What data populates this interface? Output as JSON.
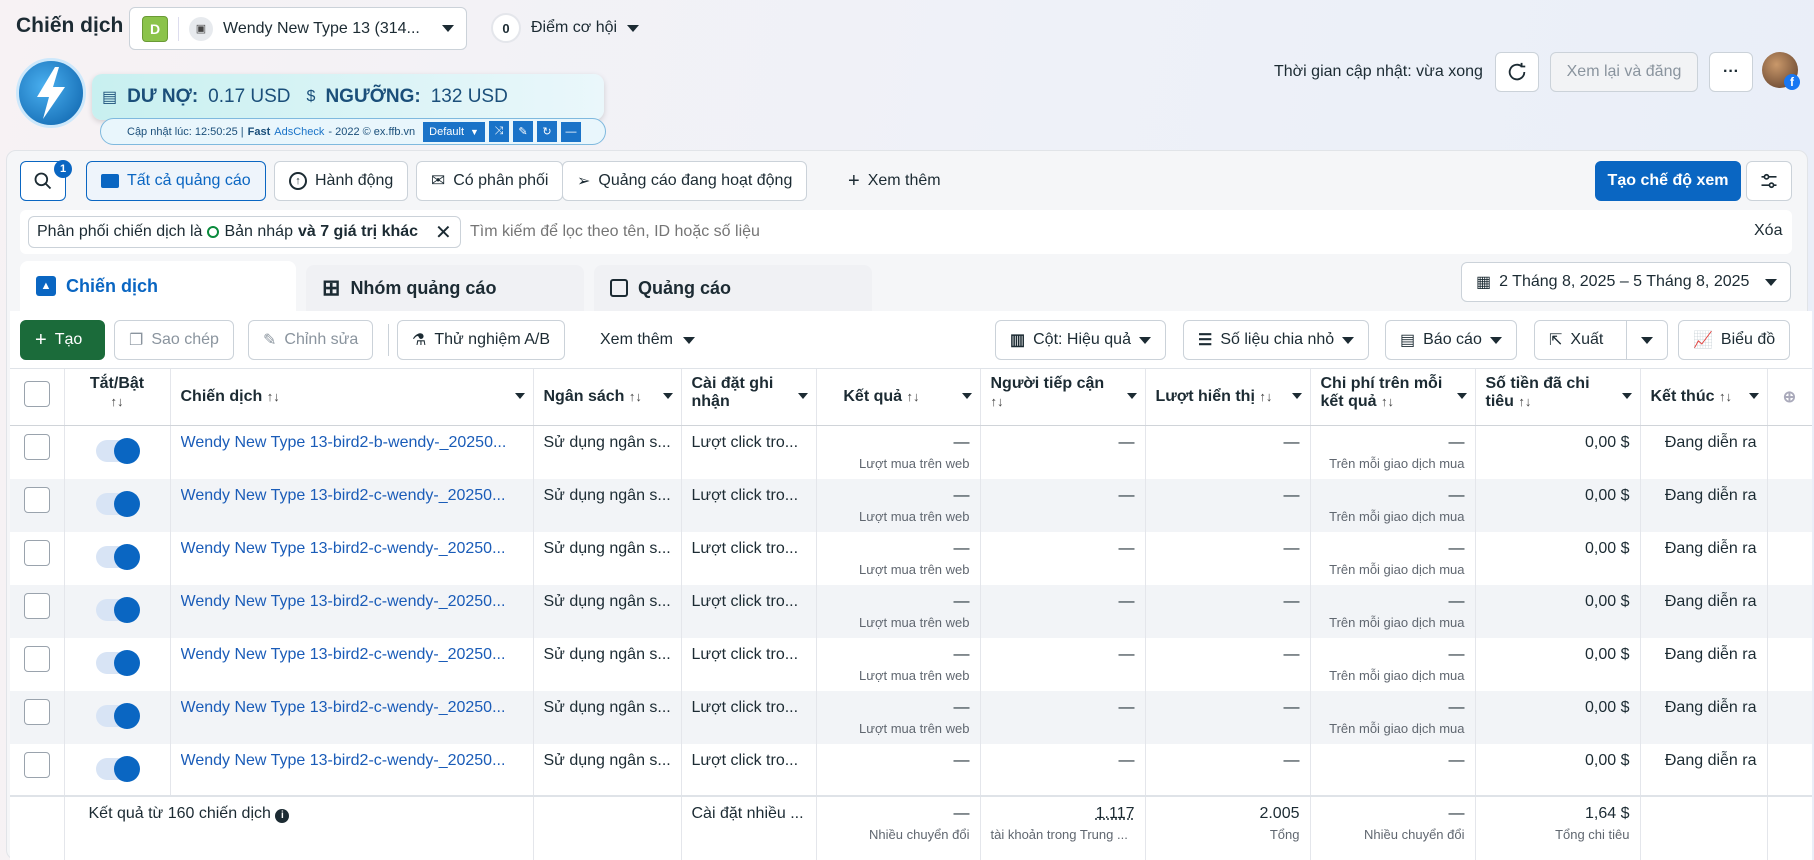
{
  "page_title": "Chiến dịch",
  "account": {
    "badge": "D",
    "name": "Wendy New Type 13 (314..."
  },
  "opportunity": {
    "count": "0",
    "label": "Điểm cơ hội"
  },
  "update": {
    "text": "Thời gian cập nhật: vừa xong",
    "review_label": "Xem lại và đăng",
    "more": "···"
  },
  "ext": {
    "debt_label": "DƯ NỢ:",
    "debt_value": "0.17 USD",
    "threshold_label": "NGƯỠNG:",
    "threshold_value": "132 USD",
    "updated": "Cập nhật lúc: 12:50:25 |",
    "brand_fast": "Fast",
    "brand_ads": "AdsCheck",
    "brand_tail": "- 2022 © ex.ffb.vn",
    "mode": "Default"
  },
  "search_badge": "1",
  "filters": {
    "all": "Tất cả quảng cáo",
    "action": "Hành động",
    "delivery": "Có phân phối",
    "active": "Quảng cáo đang hoạt động",
    "more": "Xem thêm"
  },
  "create_view": "Tạo chế độ xem",
  "filterbar": {
    "chip_prefix": "Phân phối chiến dịch là",
    "chip_value": "Bản nháp",
    "chip_more": "và 7 giá trị khác",
    "placeholder": "Tìm kiếm để lọc theo tên, ID hoặc số liệu",
    "clear": "Xóa"
  },
  "tabs": [
    "Chiến dịch",
    "Nhóm quảng cáo",
    "Quảng cáo"
  ],
  "date_range": "2 Tháng 8, 2025 – 5 Tháng 8, 2025",
  "toolbar": {
    "create": "Tạo",
    "copy": "Sao chép",
    "edit": "Chỉnh sửa",
    "ab": "Thử nghiệm A/B",
    "more": "Xem thêm",
    "columns": "Cột: Hiệu quả",
    "breakdown": "Số liệu chia nhỏ",
    "report": "Báo cáo",
    "export": "Xuất",
    "chart": "Biểu đồ"
  },
  "headers": {
    "toggle": "Tắt/Bật",
    "campaign": "Chiến dịch",
    "budget": "Ngân sách",
    "attribution": "Cài đặt ghi nhận",
    "results": "Kết quả",
    "reach": "Người tiếp cận",
    "impressions": "Lượt hiển thị",
    "cpr": "Chi phí trên mỗi kết quả",
    "spent": "Số tiền đã chi tiêu",
    "end": "Kết thúc"
  },
  "rows": [
    {
      "name": "Wendy New Type 13-bird2-b-wendy-_20250...",
      "budget": "Sử dụng ngân s...",
      "attr": "Lượt click tro...",
      "result": "—",
      "result_sub": "Lượt mua trên web",
      "reach": "—",
      "impr": "—",
      "cpr": "—",
      "cpr_sub": "Trên mỗi giao dịch mua",
      "spent": "0,00 $",
      "end": "Đang diễn ra"
    },
    {
      "name": "Wendy New Type 13-bird2-c-wendy-_20250...",
      "budget": "Sử dụng ngân s...",
      "attr": "Lượt click tro...",
      "result": "—",
      "result_sub": "Lượt mua trên web",
      "reach": "—",
      "impr": "—",
      "cpr": "—",
      "cpr_sub": "Trên mỗi giao dịch mua",
      "spent": "0,00 $",
      "end": "Đang diễn ra"
    },
    {
      "name": "Wendy New Type 13-bird2-c-wendy-_20250...",
      "budget": "Sử dụng ngân s...",
      "attr": "Lượt click tro...",
      "result": "—",
      "result_sub": "Lượt mua trên web",
      "reach": "—",
      "impr": "—",
      "cpr": "—",
      "cpr_sub": "Trên mỗi giao dịch mua",
      "spent": "0,00 $",
      "end": "Đang diễn ra"
    },
    {
      "name": "Wendy New Type 13-bird2-c-wendy-_20250...",
      "budget": "Sử dụng ngân s...",
      "attr": "Lượt click tro...",
      "result": "—",
      "result_sub": "Lượt mua trên web",
      "reach": "—",
      "impr": "—",
      "cpr": "—",
      "cpr_sub": "Trên mỗi giao dịch mua",
      "spent": "0,00 $",
      "end": "Đang diễn ra"
    },
    {
      "name": "Wendy New Type 13-bird2-c-wendy-_20250...",
      "budget": "Sử dụng ngân s...",
      "attr": "Lượt click tro...",
      "result": "—",
      "result_sub": "Lượt mua trên web",
      "reach": "—",
      "impr": "—",
      "cpr": "—",
      "cpr_sub": "Trên mỗi giao dịch mua",
      "spent": "0,00 $",
      "end": "Đang diễn ra"
    },
    {
      "name": "Wendy New Type 13-bird2-c-wendy-_20250...",
      "budget": "Sử dụng ngân s...",
      "attr": "Lượt click tro...",
      "result": "—",
      "result_sub": "Lượt mua trên web",
      "reach": "—",
      "impr": "—",
      "cpr": "—",
      "cpr_sub": "Trên mỗi giao dịch mua",
      "spent": "0,00 $",
      "end": "Đang diễn ra"
    },
    {
      "name": "Wendy New Type 13-bird2-c-wendy-_20250...",
      "budget": "Sử dụng ngân s...",
      "attr": "Lượt click tro...",
      "result": "—",
      "result_sub": "",
      "reach": "—",
      "impr": "—",
      "cpr": "—",
      "cpr_sub": "",
      "spent": "0,00 $",
      "end": "Đang diễn ra"
    }
  ],
  "summary": {
    "label": "Kết quả từ 160 chiến dịch",
    "attr": "Cài đặt nhiều ...",
    "result": "—",
    "result_sub": "Nhiều chuyển đổi",
    "reach": "1.117",
    "reach_sub": "tài khoản trong Trung ...",
    "impr": "2.005",
    "impr_sub": "Tổng",
    "cpr": "—",
    "cpr_sub": "Nhiều chuyển đổi",
    "spent": "1,64 $",
    "spent_sub": "Tổng chi tiêu"
  }
}
